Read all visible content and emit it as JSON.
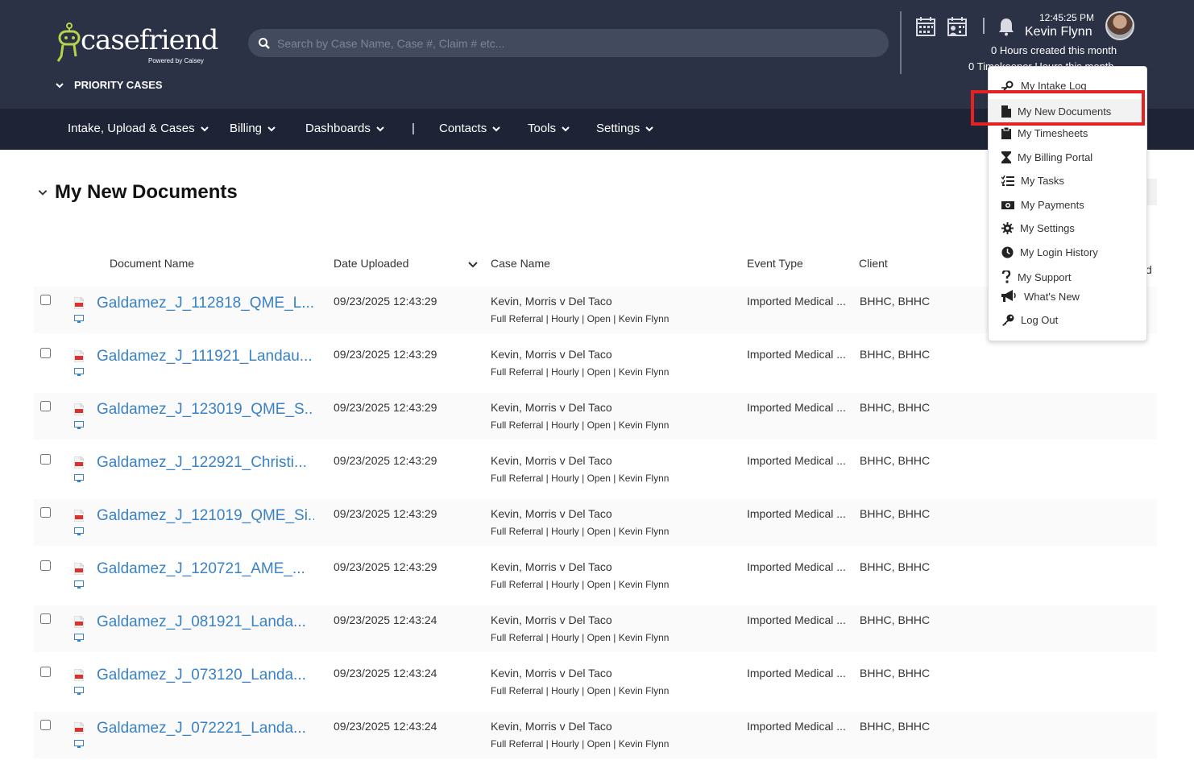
{
  "brand": {
    "name": "casefriend",
    "tagline": "Powered by Caisey"
  },
  "priority": {
    "label": "PRIORITY CASES"
  },
  "search": {
    "placeholder": "Search by Case Name, Case #, Claim # etc..."
  },
  "header": {
    "time": "12:45:25 PM",
    "user": "Kevin Flynn",
    "hours": "0 Hours created this month",
    "timekeeper": "0 Timekeeper Hours this month"
  },
  "nav": {
    "items": [
      {
        "label": "Intake, Upload & Cases"
      },
      {
        "label": "Billing"
      },
      {
        "label": "Dashboards"
      },
      {
        "label": "Contacts"
      },
      {
        "label": "Tools"
      },
      {
        "label": "Settings"
      }
    ],
    "separator": "|"
  },
  "page": {
    "title": "My New Documents"
  },
  "table": {
    "columns": [
      "Document Name",
      "Date Uploaded",
      "Case Name",
      "Event Type",
      "Client"
    ],
    "trailing_fragment": "d",
    "rows": [
      {
        "name": "Galdamez_J_112818_QME_L...",
        "date": "09/23/2025 12:43:29",
        "case": "Kevin, Morris v Del Taco",
        "case_sub": "Full Referral | Hourly | Open | Kevin Flynn",
        "event": "Imported Medical ...",
        "client": "BHHC, BHHC"
      },
      {
        "name": "Galdamez_J_111921_Landau...",
        "date": "09/23/2025 12:43:29",
        "case": "Kevin, Morris v Del Taco",
        "case_sub": "Full Referral | Hourly | Open | Kevin Flynn",
        "event": "Imported Medical ...",
        "client": "BHHC, BHHC"
      },
      {
        "name": "Galdamez_J_123019_QME_S...",
        "date": "09/23/2025 12:43:29",
        "case": "Kevin, Morris v Del Taco",
        "case_sub": "Full Referral | Hourly | Open | Kevin Flynn",
        "event": "Imported Medical ...",
        "client": "BHHC, BHHC"
      },
      {
        "name": "Galdamez_J_122921_Christi...",
        "date": "09/23/2025 12:43:29",
        "case": "Kevin, Morris v Del Taco",
        "case_sub": "Full Referral | Hourly | Open | Kevin Flynn",
        "event": "Imported Medical ...",
        "client": "BHHC, BHHC"
      },
      {
        "name": "Galdamez_J_121019_QME_Si...",
        "date": "09/23/2025 12:43:29",
        "case": "Kevin, Morris v Del Taco",
        "case_sub": "Full Referral | Hourly | Open | Kevin Flynn",
        "event": "Imported Medical ...",
        "client": "BHHC, BHHC"
      },
      {
        "name": "Galdamez_J_120721_AME_...",
        "date": "09/23/2025 12:43:29",
        "case": "Kevin, Morris v Del Taco",
        "case_sub": "Full Referral | Hourly | Open | Kevin Flynn",
        "event": "Imported Medical ...",
        "client": "BHHC, BHHC"
      },
      {
        "name": "Galdamez_J_081921_Landa...",
        "date": "09/23/2025 12:43:24",
        "case": "Kevin, Morris v Del Taco",
        "case_sub": "Full Referral | Hourly | Open | Kevin Flynn",
        "event": "Imported Medical ...",
        "client": "BHHC, BHHC"
      },
      {
        "name": "Galdamez_J_073120_Landa...",
        "date": "09/23/2025 12:43:24",
        "case": "Kevin, Morris v Del Taco",
        "case_sub": "Full Referral | Hourly | Open | Kevin Flynn",
        "event": "Imported Medical ...",
        "client": "BHHC, BHHC"
      },
      {
        "name": "Galdamez_J_072221_Landa...",
        "date": "09/23/2025 12:43:24",
        "case": "Kevin, Morris v Del Taco",
        "case_sub": "Full Referral | Hourly | Open | Kevin Flynn",
        "event": "Imported Medical ...",
        "client": "BHHC, BHHC"
      }
    ]
  },
  "menu": {
    "items": [
      {
        "label": "My Intake Log",
        "icon": "search-person-icon"
      },
      {
        "label": "My New Documents",
        "icon": "document-icon",
        "active": true
      },
      {
        "label": "My Timesheets",
        "icon": "clipboard-icon"
      },
      {
        "label": "My Billing Portal",
        "icon": "hourglass-icon"
      },
      {
        "label": "My Tasks",
        "icon": "checklist-icon"
      },
      {
        "label": "My Payments",
        "icon": "money-icon"
      },
      {
        "label": "My Settings",
        "icon": "gear-icon"
      },
      {
        "label": "My Login History",
        "icon": "clock-icon"
      },
      {
        "label": "My Support",
        "icon": "question-icon"
      },
      {
        "label": "What's New",
        "icon": "megaphone-icon"
      },
      {
        "label": "Log Out",
        "icon": "key-icon"
      }
    ]
  },
  "colors": {
    "header_bg": "#2b3246",
    "nav_bg": "#1e2435",
    "link": "#3b82c4",
    "logo_accent": "#b7d34c",
    "highlight": "#e52222"
  }
}
